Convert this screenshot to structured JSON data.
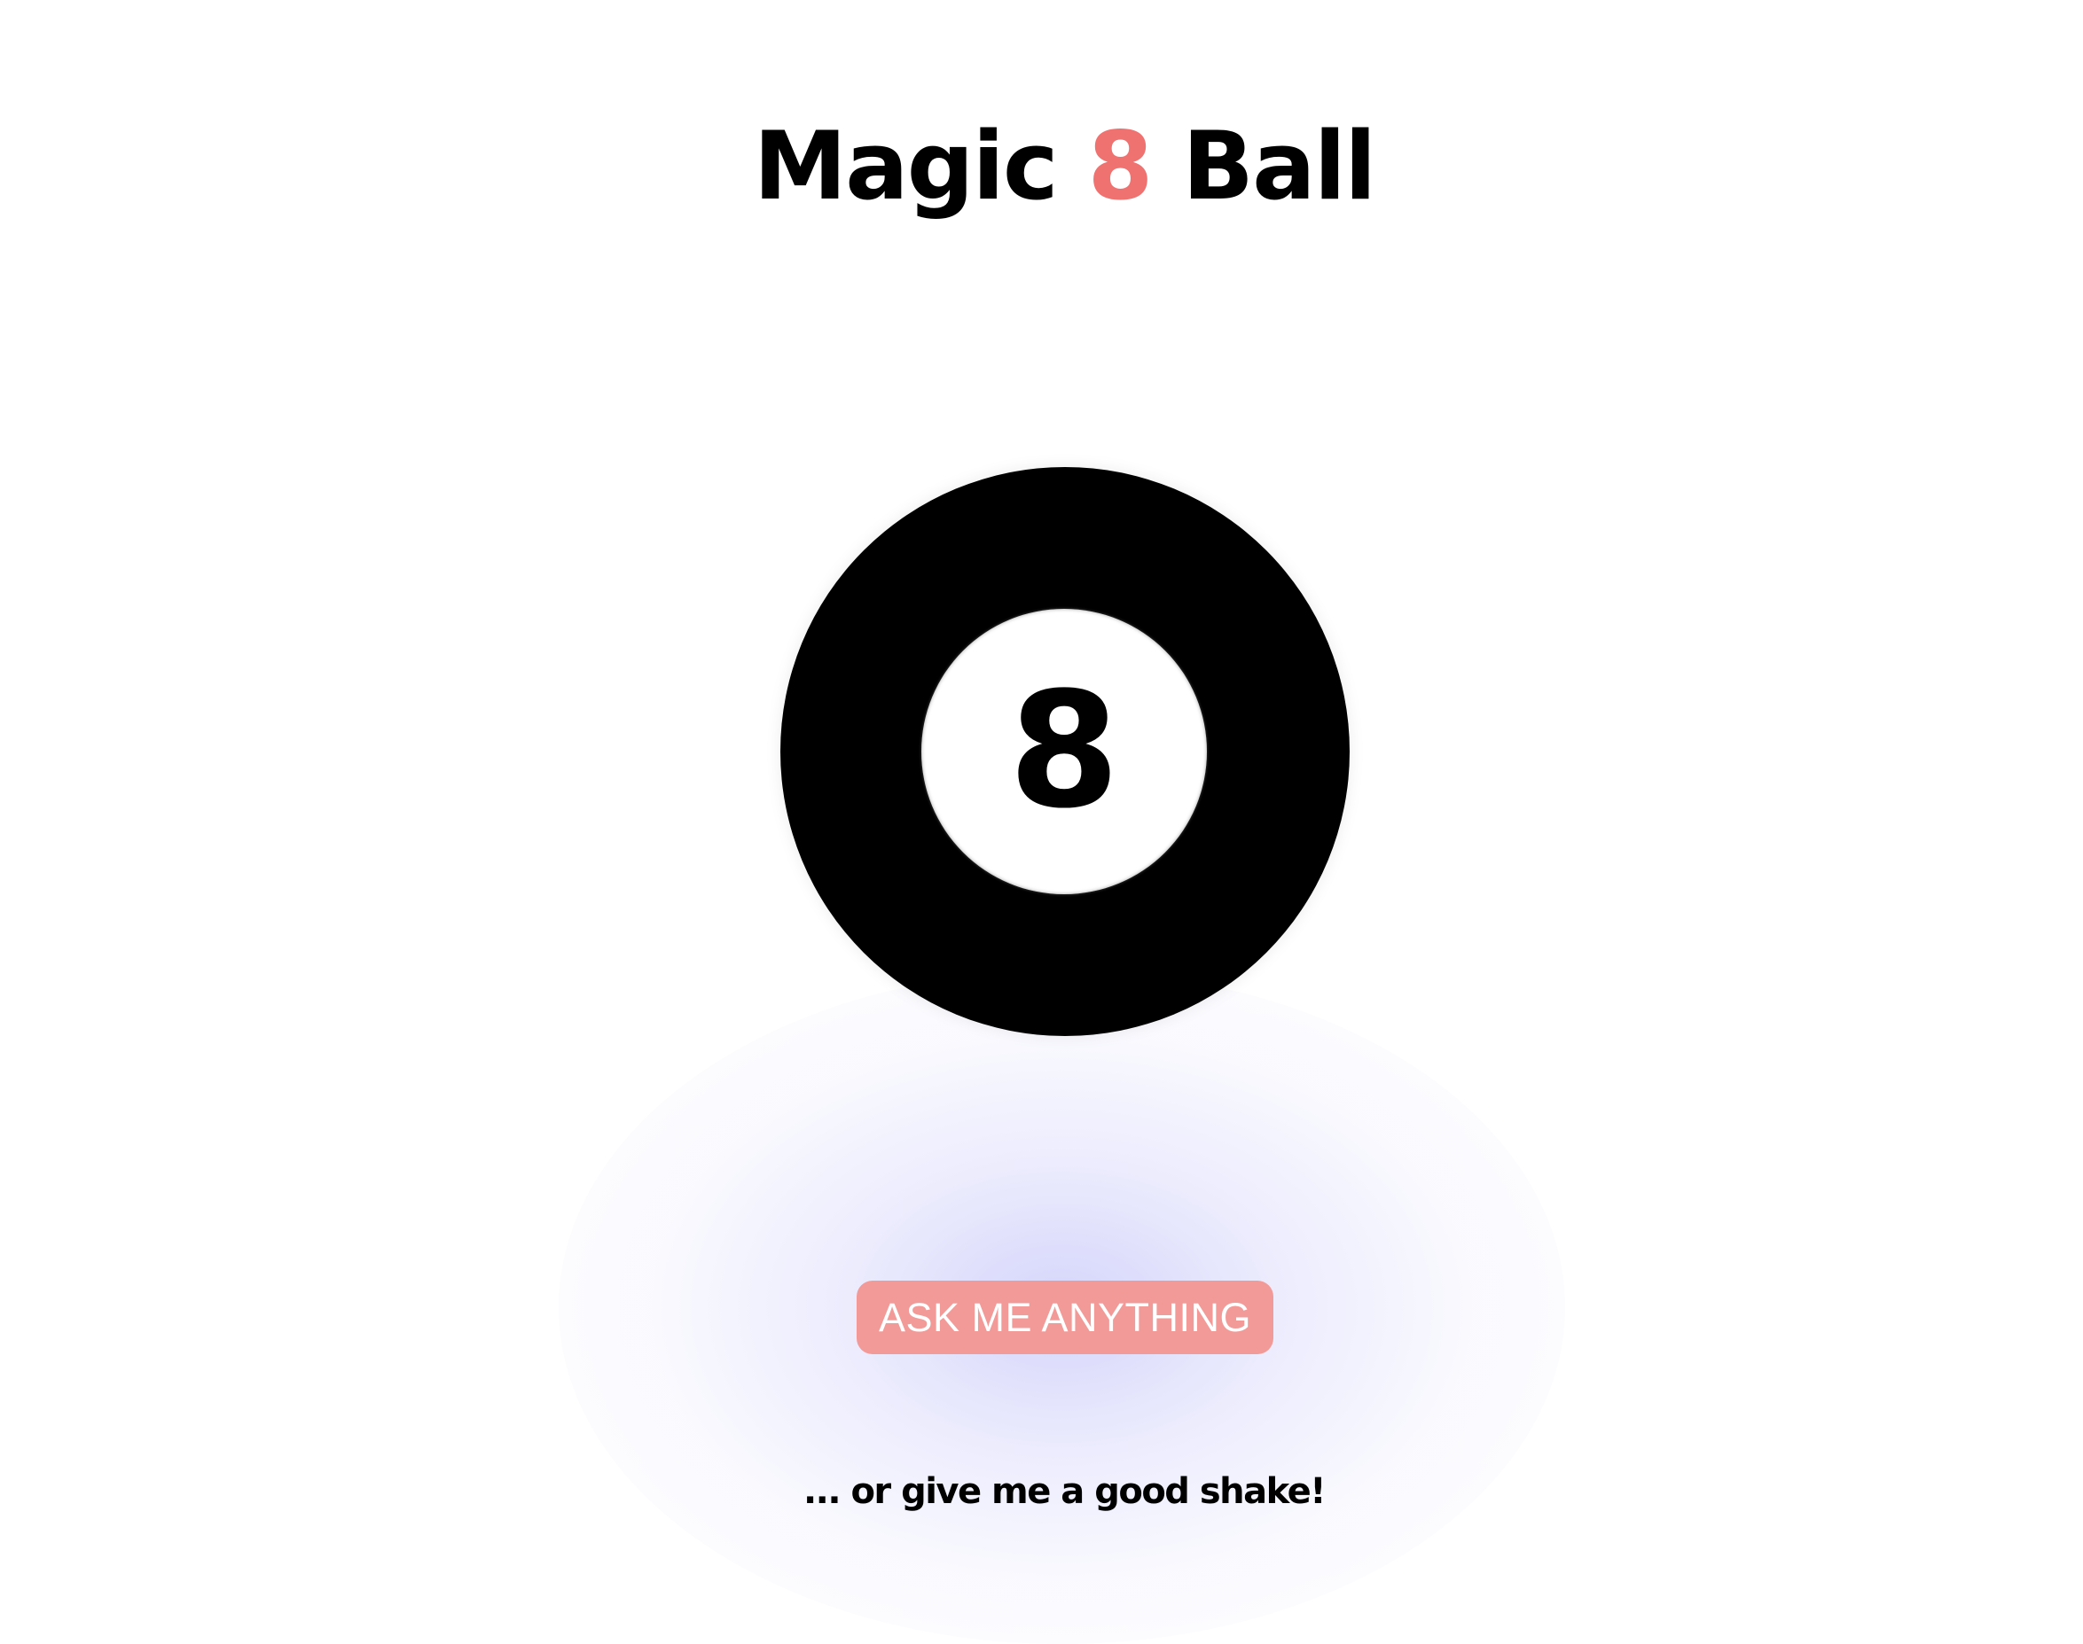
{
  "title": {
    "part1": "Magic ",
    "accent": "8",
    "part2": " Ball"
  },
  "ball": {
    "number": "8"
  },
  "ask_button": {
    "label": "ASK ME ANYTHING"
  },
  "hint": "... or give me a good shake!",
  "colors": {
    "accent": "#ef7270",
    "button_bg": "#f19a98",
    "glow": "#cdcdfa"
  }
}
